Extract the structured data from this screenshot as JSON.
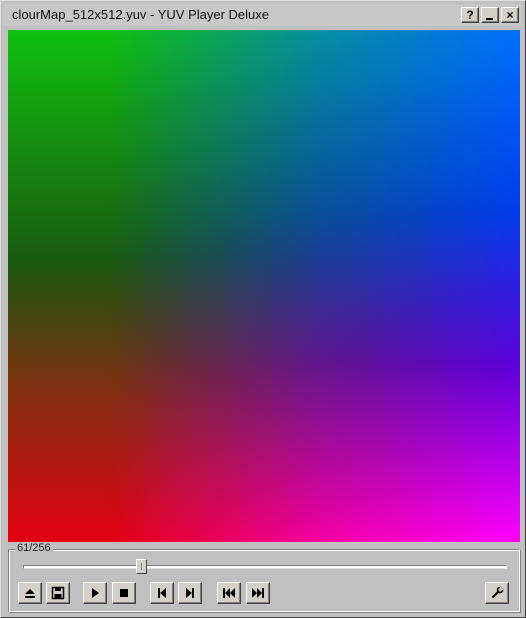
{
  "window": {
    "title": "clourMap_512x512.yuv - YUV Player Deluxe",
    "buttons": {
      "help_label": "?",
      "close_label": "×"
    }
  },
  "video": {
    "content_description_visible": false
  },
  "playback": {
    "frame_label": "61/256",
    "current_frame": 61,
    "total_frames": 256,
    "progress_fraction": 0.238
  },
  "controls": [
    {
      "name": "eject-icon"
    },
    {
      "name": "save-icon"
    },
    {
      "name": "play-icon"
    },
    {
      "name": "stop-icon"
    },
    {
      "name": "step-back-icon"
    },
    {
      "name": "step-forward-icon"
    },
    {
      "name": "skip-to-start-icon"
    },
    {
      "name": "skip-to-end-icon"
    },
    {
      "name": "settings-wrench-icon"
    }
  ],
  "colors": {
    "window_bg": "#c0c0c0",
    "button_face": "#d4d0c8",
    "title_text": "#101010"
  }
}
